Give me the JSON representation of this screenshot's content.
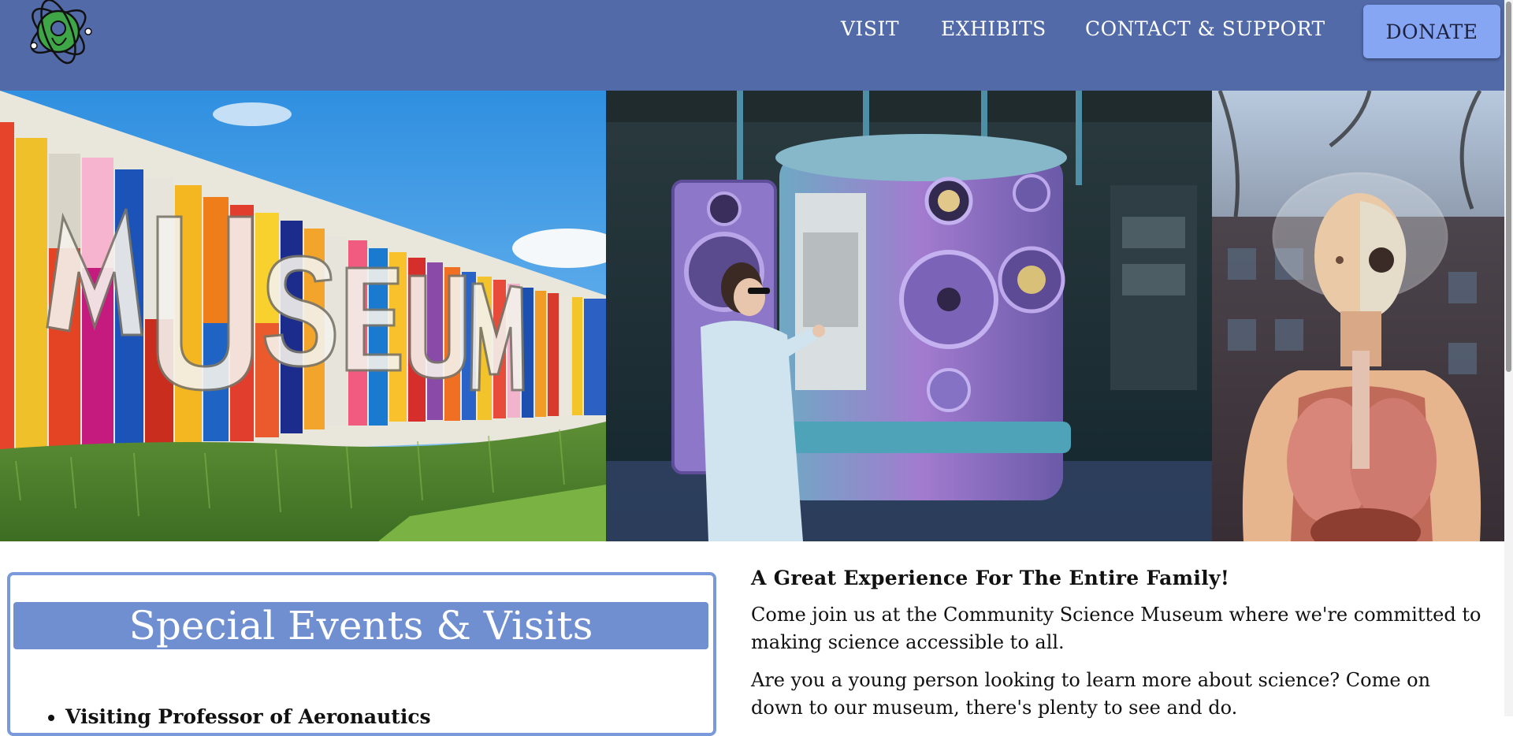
{
  "nav": {
    "visit": "VISIT",
    "exhibits": "EXHIBITS",
    "contact": "CONTACT & SUPPORT",
    "donate": "DONATE"
  },
  "hero": {
    "panels": [
      "museum-facade-image",
      "scientist-lab-image",
      "anatomy-model-image"
    ]
  },
  "events": {
    "title": "Special Events & Visits",
    "items": [
      "Visiting Professor of Aeronautics"
    ]
  },
  "intro": {
    "heading": "A Great Experience For The Entire Family!",
    "paragraphs": [
      "Come join us at the Community Science Museum where we're committed to making science accessible to all.",
      "Are you a young person looking to learn more about science? Come on down to our museum, there's plenty to see and do."
    ]
  },
  "colors": {
    "header_bg": "#536aa9",
    "donate_bg": "#86a5f3",
    "events_banner": "#6f8fd1",
    "events_border": "#7a99db"
  }
}
